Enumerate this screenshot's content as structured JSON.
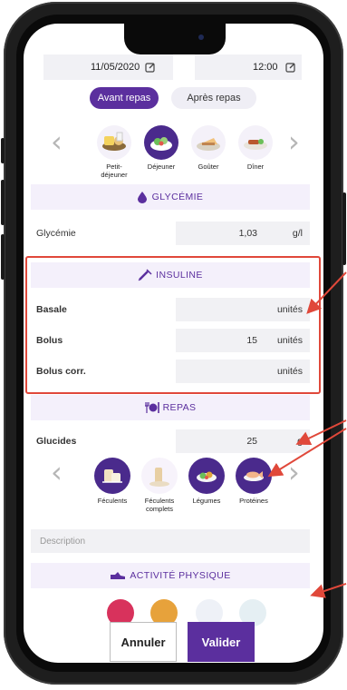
{
  "header": {
    "date": "11/05/2020",
    "time": "12:00"
  },
  "tabs": [
    {
      "label": "Avant repas",
      "active": true
    },
    {
      "label": "Après repas",
      "active": false
    }
  ],
  "meals": [
    {
      "label": "Petit-\ndéjeuner",
      "icon": "croissant-icon"
    },
    {
      "label": "Déjeuner",
      "icon": "salad-bowl-icon",
      "selected": true
    },
    {
      "label": "Goûter",
      "icon": "cake-icon"
    },
    {
      "label": "Dîner",
      "icon": "dinner-plate-icon"
    }
  ],
  "glycemie": {
    "section": "GLYCÉMIE",
    "label": "Glycémie",
    "value": "1,03",
    "unit": "g/l"
  },
  "insuline": {
    "section": "INSULINE",
    "rows": [
      {
        "label": "Basale",
        "value": "",
        "unit": "unités"
      },
      {
        "label": "Bolus",
        "value": "15",
        "unit": "unités"
      },
      {
        "label": "Bolus corr.",
        "value": "",
        "unit": "unités"
      }
    ]
  },
  "repas": {
    "section": "REPAS",
    "glucides_label": "Glucides",
    "glucides_value": "25",
    "glucides_unit": "g",
    "foods": [
      {
        "label": "Féculents",
        "icon": "bread-icon",
        "selected": true
      },
      {
        "label": "Féculents\ncomplets",
        "icon": "wholegrain-bread-icon",
        "selected": false
      },
      {
        "label": "Légumes",
        "icon": "vegetables-icon",
        "selected": true
      },
      {
        "label": "Protéines",
        "icon": "fish-icon",
        "selected": true
      }
    ],
    "description_placeholder": "Description"
  },
  "activite": {
    "section": "ACTIVITÉ PHYSIQUE"
  },
  "buttons": {
    "cancel": "Annuler",
    "validate": "Valider"
  },
  "colors": {
    "accent": "#5b2f9e",
    "highlight": "#e0483a",
    "section_bg": "#f4f0fb"
  }
}
